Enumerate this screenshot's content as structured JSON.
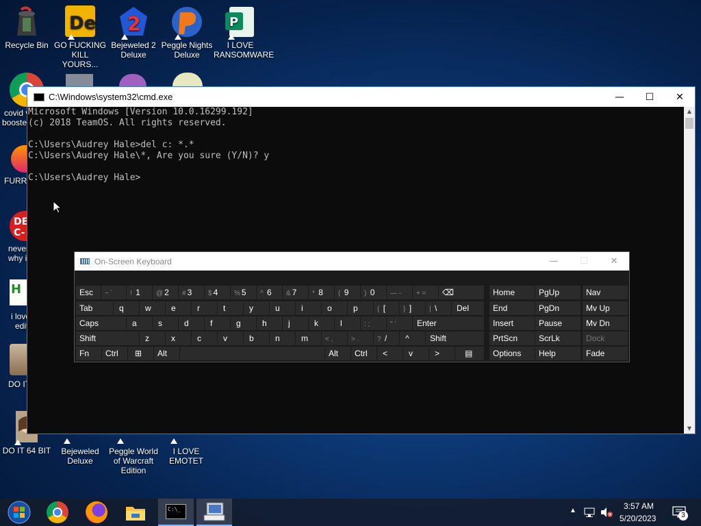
{
  "desktop": {
    "icons": [
      {
        "label": "Recycle Bin"
      },
      {
        "label": "GO FUCKING KILL YOURS..."
      },
      {
        "label": "Bejeweled 2 Deluxe"
      },
      {
        "label": "Peggle Nights Deluxe"
      },
      {
        "label": "I LOVE RANSOMWARE"
      },
      {
        "label": "DO IT 64 BIT"
      },
      {
        "label": "Bejeweled Deluxe"
      },
      {
        "label": "Peggle World of Warcraft Edition"
      },
      {
        "label": "I LOVE EMOTET"
      }
    ],
    "partial_labels": [
      "covid v",
      "booster",
      "FURRY",
      "never",
      "why is",
      "i love",
      "edit",
      "DO IT"
    ]
  },
  "cmd": {
    "title": "C:\\Windows\\system32\\cmd.exe",
    "lines": [
      "Microsoft Windows [Version 10.0.16299.192]",
      "(c) 2018 TeamOS. All rights reserved.",
      "",
      "C:\\Users\\Audrey Hale>del c: *.*",
      "C:\\Users\\Audrey Hale\\*, Are you sure (Y/N)? y",
      "",
      "C:\\Users\\Audrey Hale>"
    ],
    "controls": {
      "minimize": "—",
      "maximize": "☐",
      "close": "✕"
    }
  },
  "osk": {
    "title": "On-Screen Keyboard",
    "keys": {
      "esc": "Esc",
      "tilde_sub": "~ `",
      "k1_sub": "!",
      "k1": "1",
      "k2_sub": "@",
      "k2": "2",
      "k3_sub": "#",
      "k3": "3",
      "k4_sub": "$",
      "k4": "4",
      "k5_sub": "%",
      "k5": "5",
      "k6_sub": "^",
      "k6": "6",
      "k7_sub": "&",
      "k7": "7",
      "k8_sub": "*",
      "k8": "8",
      "k9_sub": "(",
      "k9": "9",
      "k0_sub": ")",
      "k0": "0",
      "minus": "— -",
      "plus": "+ =",
      "backspace": "⌫",
      "tab": "Tab",
      "q": "q",
      "w": "w",
      "e": "e",
      "r": "r",
      "t": "t",
      "y": "y",
      "u": "u",
      "i": "i",
      "o": "o",
      "p": "p",
      "lbr_sub": "{",
      "lbr": "[",
      "rbr_sub": "}",
      "rbr": "]",
      "pipe_sub": "|",
      "pipe": "\\",
      "del": "Del",
      "caps": "Caps",
      "a": "a",
      "s": "s",
      "d": "d",
      "f": "f",
      "g": "g",
      "h": "h",
      "j": "j",
      "k": "k",
      "l": "l",
      "colon": ": ;",
      "quote": "\" '",
      "enter": "Enter",
      "shift": "Shift",
      "z": "z",
      "x": "x",
      "c": "c",
      "v": "v",
      "b": "b",
      "n": "n",
      "m": "m",
      "comma": "< ,",
      "period": "> .",
      "slash_sub": "?",
      "slash": "/",
      "up": "^",
      "rshift": "Shift",
      "fn": "Fn",
      "ctrl": "Ctrl",
      "win": "⊞",
      "alt": "Alt",
      "ralt": "Alt",
      "rctrl": "Ctrl",
      "left": "<",
      "down": "v",
      "right": ">",
      "menu": "▤",
      "home": "Home",
      "pgup": "PgUp",
      "nav": "Nav",
      "end": "End",
      "pgdn": "PgDn",
      "mvup": "Mv Up",
      "insert": "Insert",
      "pause": "Pause",
      "mvdn": "Mv Dn",
      "prtscn": "PrtScn",
      "scrlk": "ScrLk",
      "dock": "Dock",
      "options": "Options",
      "help": "Help",
      "fade": "Fade"
    }
  },
  "taskbar": {
    "time": "3:57 AM",
    "date": "5/20/2023",
    "notification_count": "3",
    "apps": [
      "start-button",
      "chrome",
      "firefox",
      "file-explorer",
      "cmd",
      "on-screen-keyboard"
    ]
  }
}
